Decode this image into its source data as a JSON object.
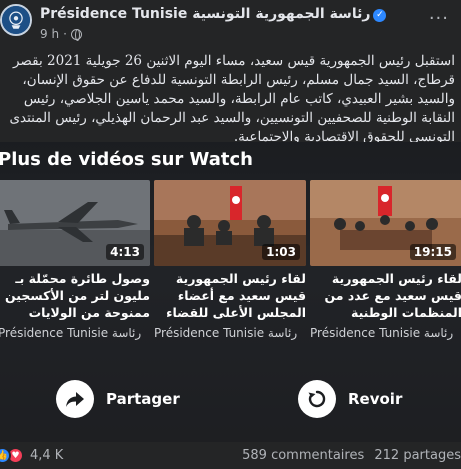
{
  "post": {
    "page_name": "Présidence Tunisie رئاسة الجمهورية التونسية",
    "time": "9 h",
    "text": "استقبل رئيس الجمهورية قيس سعيد، مساء اليوم الاثنين 26 جويلية 2021 بقصر قرطاج، السيد جمال مسلم، رئيس الرابطة التونسية للدفاع عن حقوق الإنسان، والسيد بشير العبيدي، كاتب عام الرابطة، والسيد محمد ياسين الجلاصي، رئيس النقابة الوطنية للصحفيين التونسيين، والسيد عبد الرحمان الهذيلي، رئيس المنتدى التونسي للحقوق الاقتصادية والاجتماعية."
  },
  "watch": {
    "heading": "Plus de vidéos sur Watch",
    "videos": [
      {
        "duration": "4:13",
        "title": "وصول طائرة محمّلة بـ مليون لتر من الأكسجين ممنوحة من الولايات المتحدة الأمريكية",
        "source": "Présidence Tunisie رئاسة"
      },
      {
        "duration": "1:03",
        "title": "لقاء رئيس الجمهورية قيس سعيد مع أعضاء المجلس الأعلى للقضاء",
        "source": "Présidence Tunisie رئاسة"
      },
      {
        "duration": "19:15",
        "title": "لقاء رئيس الجمهورية قيس سعيد مع عدد من المنظمات الوطنية",
        "source": "Présidence Tunisie رئاسة"
      }
    ],
    "share_label": "Partager",
    "replay_label": "Revoir"
  },
  "footer": {
    "reactions_count": "4,4 K",
    "comments": "589 commentaires",
    "shares": "212 partages"
  },
  "colors": {
    "background": "#242526",
    "text_primary": "#e4e6eb",
    "text_secondary": "#b0b3b8",
    "like_blue": "#2d88ff",
    "love_red": "#f33e58"
  },
  "icons": [
    "presidency-logo-icon",
    "verified-badge-icon",
    "globe-icon",
    "more-options-icon",
    "share-arrow-icon",
    "replay-icon",
    "like-reaction-icon",
    "love-reaction-icon"
  ]
}
